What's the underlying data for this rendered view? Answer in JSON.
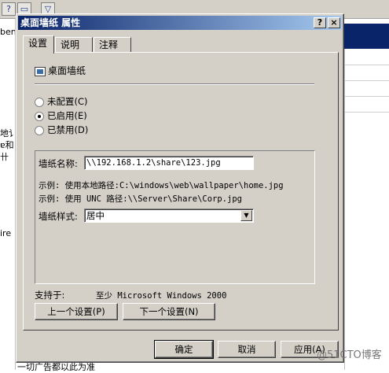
{
  "background": {
    "left_text": [
      "ben",
      "地讠",
      "ɐ和",
      "卄",
      "ire"
    ],
    "bottom_text": "一切广告都以此为准",
    "watermark": "@51CTO博客"
  },
  "dialog": {
    "title": "桌面墙纸 属性",
    "help_button": "?",
    "close_button": "×",
    "tabs": [
      {
        "label": "设置",
        "active": true
      },
      {
        "label": "说明",
        "active": false
      },
      {
        "label": "注释",
        "active": false
      }
    ],
    "setting_name": "桌面墙纸",
    "radios": [
      {
        "label": "未配置(C)",
        "checked": false
      },
      {
        "label": "已启用(E)",
        "checked": true
      },
      {
        "label": "已禁用(D)",
        "checked": false
      }
    ],
    "wallpaper_name_label": "墙纸名称:",
    "wallpaper_name_value": "\\\\192.168.1.2\\share\\123.jpg",
    "example_local": "示例: 使用本地路径:C:\\windows\\web\\wallpaper\\home.jpg",
    "example_unc": "示例: 使用 UNC 路径:\\\\Server\\Share\\Corp.jpg",
    "wallpaper_style_label": "墙纸样式:",
    "wallpaper_style_value": "居中",
    "supported_label": "支持于:",
    "supported_value": "至少 Microsoft Windows 2000",
    "prev_button": "上一个设置(P)",
    "next_button": "下一个设置(N)",
    "ok_button": "确定",
    "cancel_button": "取消",
    "apply_button": "应用(A)"
  }
}
